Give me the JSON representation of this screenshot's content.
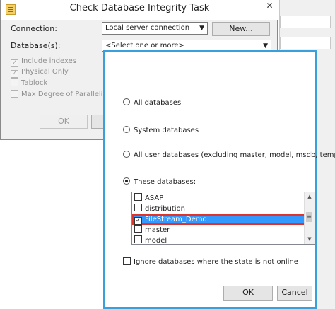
{
  "dialog": {
    "title": "Check Database Integrity Task",
    "close_glyph": "✕",
    "connection_label": "Connection:",
    "connection_value": "Local server connection",
    "new_button": "New...",
    "databases_label": "Database(s):",
    "databases_value": "<Select one or more>",
    "options": [
      {
        "label": "Include indexes",
        "checked": true
      },
      {
        "label": "Physical Only",
        "checked": true
      },
      {
        "label": "Tablock",
        "checked": false
      },
      {
        "label": "Max Degree of Parallelism",
        "checked": false
      }
    ],
    "ok_button": "OK"
  },
  "popup": {
    "radios": [
      {
        "label": "All databases",
        "selected": false
      },
      {
        "label": "System databases",
        "selected": false
      },
      {
        "label": "All user databases  (excluding master, model, msdb, tempdb)",
        "selected": false
      },
      {
        "label": "These databases:",
        "selected": true
      }
    ],
    "databases": [
      {
        "name": "ASAP",
        "checked": false,
        "selected": false
      },
      {
        "name": "distribution",
        "checked": false,
        "selected": false
      },
      {
        "name": "FileStream_Demo",
        "checked": true,
        "selected": true
      },
      {
        "name": "master",
        "checked": false,
        "selected": false
      },
      {
        "name": "model",
        "checked": false,
        "selected": false
      }
    ],
    "ignore_offline_label": "Ignore databases where the state is not online",
    "ok_button": "OK",
    "cancel_button": "Cancel"
  }
}
